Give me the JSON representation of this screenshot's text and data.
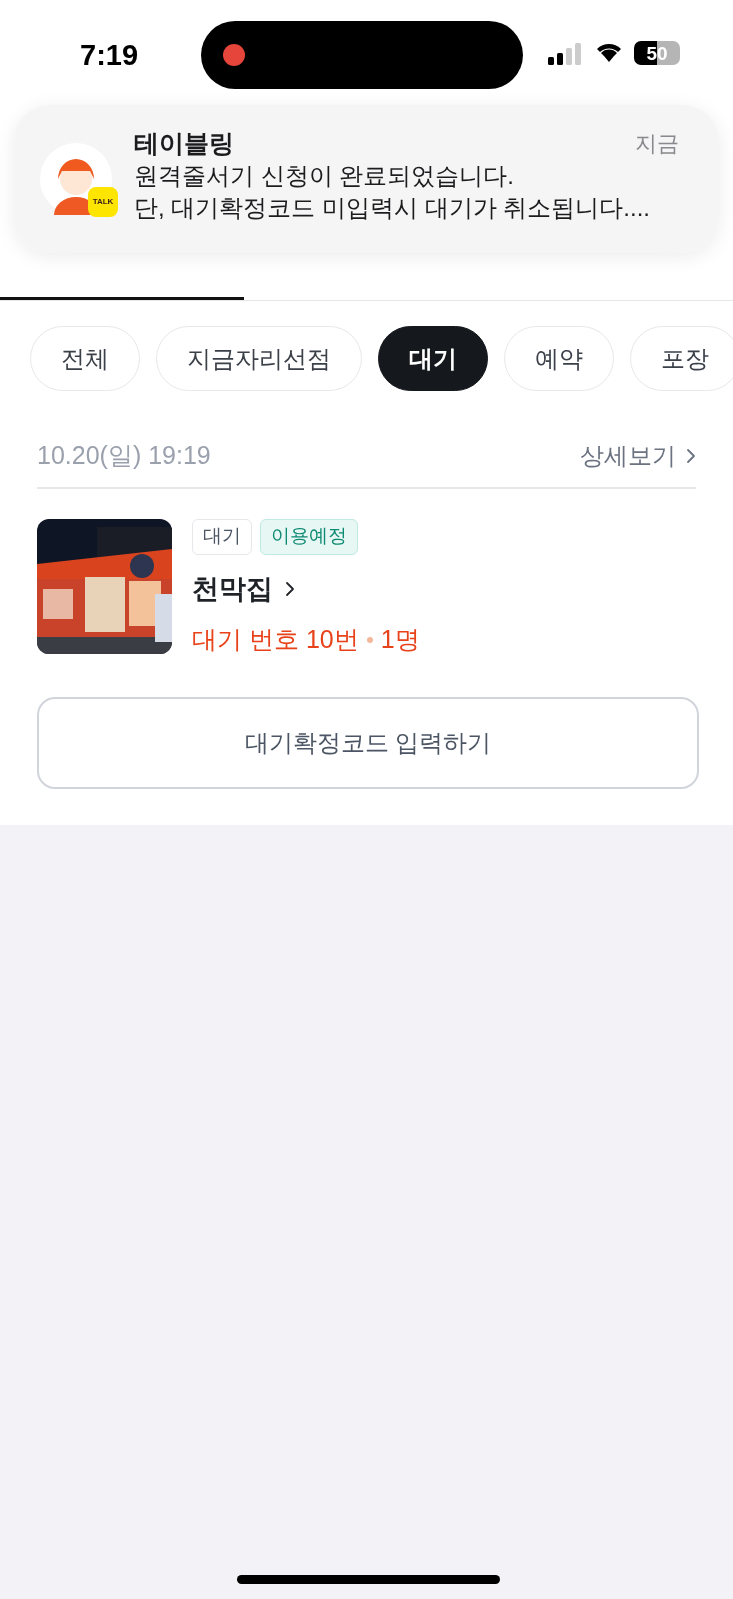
{
  "status_bar": {
    "time": "7:19",
    "recording": true,
    "battery": "50"
  },
  "notification": {
    "app": "테이블링",
    "time": "지금",
    "lines": [
      "원격줄서기 신청이 완료되었습니다.",
      "단, 대기확정코드 미입력시 대기가 취소됩니다...."
    ],
    "badge": "TALK"
  },
  "tabs": [
    {
      "selected": true
    },
    {
      "selected": false
    },
    {
      "selected": false
    }
  ],
  "filters": [
    {
      "label": "전체",
      "selected": false
    },
    {
      "label": "지금자리선점",
      "selected": false
    },
    {
      "label": "대기",
      "selected": true
    },
    {
      "label": "예약",
      "selected": false
    },
    {
      "label": "포장",
      "selected": false
    }
  ],
  "booking": {
    "date": "10.20(일) 19:19",
    "details_link": "상세보기",
    "tags": [
      {
        "label": "대기",
        "kind": "plain"
      },
      {
        "label": "이용예정",
        "kind": "status"
      }
    ],
    "store": "천막집",
    "queue": "대기 번호 10번",
    "party": "1명",
    "code_button": "대기확정코드 입력하기"
  }
}
